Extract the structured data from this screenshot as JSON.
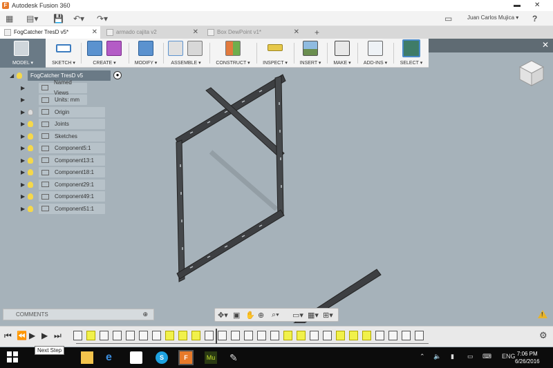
{
  "window": {
    "title": "Autodesk Fusion 360"
  },
  "quick_access": {
    "user_name": "Juan Carlos Mujica ▾",
    "help": "?"
  },
  "tabs": [
    {
      "label": "FogCatcher TresD v5*",
      "active": true
    },
    {
      "label": "armado cajita v2",
      "active": false
    },
    {
      "label": "Box DewPoint v1*",
      "active": false
    }
  ],
  "toolbar": {
    "model": "MODEL ▾",
    "groups": [
      "SKETCH ▾",
      "CREATE ▾",
      "MODIFY ▾",
      "ASSEMBLE ▾",
      "CONSTRUCT ▾",
      "INSPECT ▾",
      "INSERT ▾",
      "MAKE ▾",
      "ADD-INS ▾",
      "SELECT ▾"
    ]
  },
  "browser": {
    "root": "FogCatcher TresD v5",
    "items": [
      {
        "label": "Named Views",
        "bulb": false,
        "folder": false
      },
      {
        "label": "Units: mm",
        "bulb": false,
        "folder": false
      },
      {
        "label": "Origin",
        "bulb": true,
        "folder": true,
        "bulb_on": false
      },
      {
        "label": "Joints",
        "bulb": true,
        "folder": true,
        "bulb_on": true
      },
      {
        "label": "Sketches",
        "bulb": true,
        "folder": true,
        "bulb_on": true
      },
      {
        "label": "Component5:1",
        "bulb": true,
        "folder": false,
        "bulb_on": true
      },
      {
        "label": "Component13:1",
        "bulb": true,
        "folder": false,
        "bulb_on": true
      },
      {
        "label": "Component18:1",
        "bulb": true,
        "folder": false,
        "bulb_on": true
      },
      {
        "label": "Component29:1",
        "bulb": true,
        "folder": false,
        "bulb_on": true
      },
      {
        "label": "Component49:1",
        "bulb": true,
        "folder": false,
        "bulb_on": true
      },
      {
        "label": "Component51:1",
        "bulb": true,
        "folder": false,
        "bulb_on": true
      }
    ]
  },
  "comments": {
    "label": "COMMENTS"
  },
  "timeline": {
    "tooltip": "Next Step"
  },
  "taskbar": {
    "time": "7:06 PM",
    "date": "6/26/2016",
    "lang": "ENG"
  },
  "colors": {
    "viewport": "#a6b2ba",
    "highlight": "#f1f14b",
    "model_tab": "#6a7a86"
  }
}
